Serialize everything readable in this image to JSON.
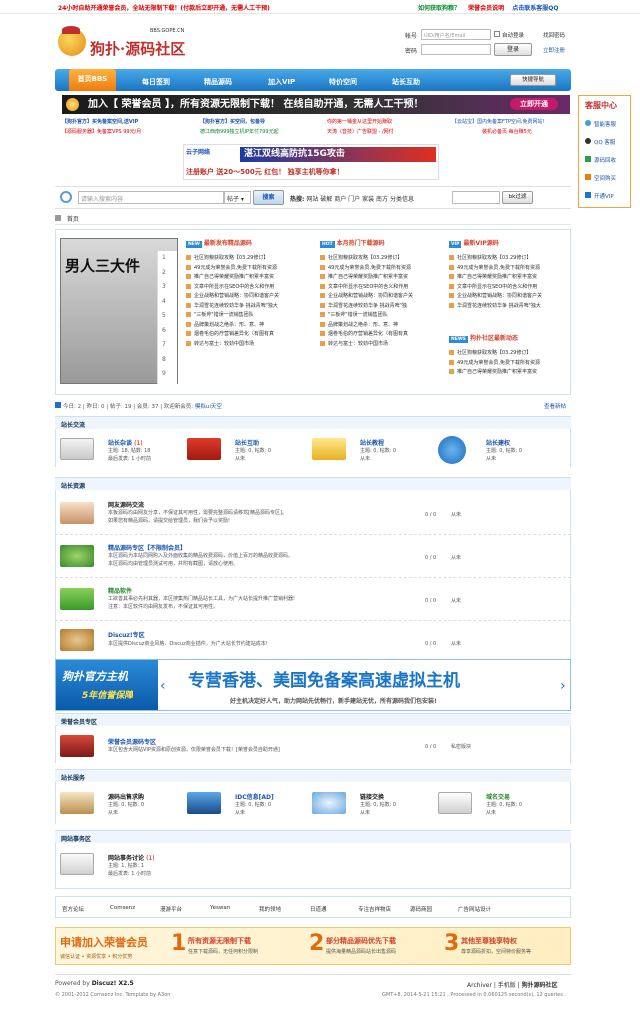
{
  "topbar": {
    "promo": "24小时自助开通荣誉会员，全站无限制下载！(付款后立即开通，无需人工干预)",
    "links": [
      "如何获取狗粮？",
      "荣誉会员说明",
      "点击联系客服QQ"
    ]
  },
  "logo": {
    "name": "狗扑·源码社区",
    "url": "BBS.GOPE.CN"
  },
  "login": {
    "account_label": "帐号",
    "account_placeholder": "UID/用户名/Email",
    "auto_login": "自动登录",
    "forgot": "找回密码",
    "password_label": "密码",
    "login_btn": "登录",
    "register": "立即注册"
  },
  "nav": {
    "items": [
      "首页BBS",
      "每日签到",
      "精品源码",
      "加入VIP",
      "特价空间",
      "站长互助"
    ],
    "quick": "快捷导航"
  },
  "banner": {
    "text": "加入【 荣誉会员 】，所有资源无限制下载！  在线自助开通，无需人工干预！",
    "button": "立即开通"
  },
  "ads": {
    "row1": [
      "【狗扑官方】买免备案空间,送VIP",
      "【狗扑官方】买空间，包备导",
      "你的第一桶金从这里开始赚取",
      "【云站宝】国内免备案FTP空间,免费网站!"
    ],
    "row2": [
      "【源码服务器】免备案VPS 99元/月",
      "德江西南999独立机IP年付799元起",
      "天涛（音技）广告联盟 - /网付",
      "装机必备页 每台赚5元"
    ],
    "middle_main": "湛江双线高防抗15G攻击",
    "middle_sub": "注册账户 送20～500元 红包！ 独享主机等你拿！"
  },
  "sidebar": {
    "title": "客服中心",
    "items": [
      "智能客服",
      "QQ 客服",
      "源码回收",
      "空间购买",
      "开通VIP"
    ]
  },
  "search": {
    "placeholder": "请输入搜索内容",
    "scope": "帖子",
    "button": "搜索",
    "hot_label": "热搜:",
    "hot": [
      "网站",
      "破解",
      "商户",
      "门户",
      "家装",
      "南方",
      "分类信息"
    ],
    "btn2": "bk过滤"
  },
  "breadcrumb": "首页",
  "featured": {
    "image_caption": "男人三大件",
    "columns": [
      {
        "title": "最新发布精品源码",
        "items": [
          "社区狗粮获取攻略【03.29修订】",
          "49元成为荣誉会员,免费下载所有资源",
          "推广自己得荣耀奖励推广积累丰富资",
          "文章中所显示在SEO中的含义和作用",
          "企业战略和营销战略：协同和谐客户关",
          "华润雪花连续较劲华争 挑战青啤\"独大",
          "\"三板斧\"错误一流销售团队",
          "品牌策划战之绝杀：形、意、神",
          "烟卷毛伯的疗营销差异化（有图有真",
          "转达与富士：较劲中国市场"
        ]
      },
      {
        "title": "本月热门下载源码",
        "items": [
          "社区狗粮获取攻略【03.29修订】",
          "49元成为荣誉会员,免费下载所有资源",
          "推广自己得荣耀奖励推广积累丰富资",
          "文章中所显示在SEO中的含义和作用",
          "企业战略和营销战略：协同和谐客户关",
          "华润雪花连续较劲华争 挑战青啤\"独",
          "\"三板斧\"错误一流销售团队",
          "品牌策划战之绝杀：形、意、神",
          "烟卷毛伯的疗营销差异化（有图有真",
          "转达与富士：较劲中国市场"
        ]
      },
      {
        "title": "最新VIP源码",
        "items": [
          "社区狗粮获取攻略【03.29修订】",
          "49元成为荣誉会员,免费下载所有资源",
          "推广自己得荣耀奖励推广积累丰富资",
          "文章中所显示在SEO中的含义和作用",
          "企业战略和营销战略：协同和谐客户关",
          "华润雪花连续较劲华争 挑战青啤\"独大"
        ]
      },
      {
        "title": "狗扑社区最新动态",
        "items": [
          "社区狗粮获取攻略【03.29修订】",
          "49元成为荣誉会员,免费下载所有资源",
          "推广自己得荣耀奖励推广积累丰富资"
        ]
      }
    ]
  },
  "stats": {
    "text": "今日: 2 | 昨日: 0 | 帖子: 19 | 会员: 37 | 欢迎新会员: ",
    "newest": "模拟ui天空",
    "link": "查看新帖"
  },
  "sections": {
    "s1": "站长交流",
    "s2": "站长资源",
    "s3": "荣誉会员专区",
    "s4": "站长服务",
    "s5": "网站事务区"
  },
  "forums_grid1": [
    {
      "name": "站长杂谈",
      "count": "(1)",
      "l1": "主题: 18, 帖数: 18",
      "l2": "最后发表: 1 小时前"
    },
    {
      "name": "站长互助",
      "l1": "主题: 0, 帖数: 0",
      "l2": "从未"
    },
    {
      "name": "站长教程",
      "l1": "主题: 0, 帖数: 0",
      "l2": "从未"
    },
    {
      "name": "站长建权",
      "l1": "主题: 0, 帖数: 0",
      "l2": "从未"
    }
  ],
  "forums_list": [
    {
      "name": "网友源码交流",
      "desc1": "本板源码均由网友分享，不保证其可用性，需要完整源码请移驾[精品源码专区]。",
      "desc2": "如果您有精品源码，请提交给管理员，我们会予以奖励!",
      "num": "0 / 0",
      "last": "从未"
    },
    {
      "name": "精品源码专区【不限制会员】",
      "desc1": "本区源码为本站同网购入及外面收集的精品收费源码，价值上百万的精品收费源码。",
      "desc2": "本区源码均由管理员测试可用，并附有截图，请放心使用。",
      "num": "0 / 0",
      "last": "从未"
    },
    {
      "name": "精品软件",
      "desc1": "工欲善其事必先利其器，本区搜集热门精品站长工具，为广大站长提升推广营销利器!",
      "desc2": "注意：本区软件均由网友发布，不保证其可用性。",
      "num": "0 / 0",
      "last": "从未"
    },
    {
      "name": "Discuz!专区",
      "desc1": "本区提供Discuz商业风格、Discuz商业插件，为广大站长节约建站成本!",
      "num": "0 / 0",
      "last": "从未"
    }
  ],
  "adbanner": {
    "left1": "狗扑官方主机",
    "left2": "5年信誉保障",
    "main": "专营香港、美国免备案高速虚拟主机",
    "sub": "好主机决定好人气，助力网站先优畅行，新手建站无忧，所有源码我们包安装!"
  },
  "vip_forum": {
    "name": "荣誉会员源码专区",
    "desc": "本区包含大网站VIP资源和原创资源，仅限荣誉会员下载！[荣誉会员自助开通]",
    "num": "0 / 0",
    "last": "私密版块"
  },
  "forums_grid2": [
    {
      "name": "源码出售求购",
      "l1": "主题: 0, 帖数: 0",
      "l2": "从未"
    },
    {
      "name": "IDC信息[AD]",
      "l1": "主题: 0, 帖数: 0",
      "l2": "从未"
    },
    {
      "name": "链接交换",
      "l1": "主题: 0, 帖数: 0",
      "l2": "从未"
    },
    {
      "name": "域名交易",
      "l1": "主题: 0, 帖数: 0",
      "l2": "从未"
    }
  ],
  "site_forum": {
    "name": "网站事务讨论",
    "count": "(1)",
    "l1": "主题: 1, 帖数: 1",
    "l2": "最后发表: 1 小时前"
  },
  "friendlinks": [
    "官方论坛",
    "Comsenz",
    "漫游平台",
    "Yeswan",
    "我的领地",
    "日道通",
    "专注吉祥物店",
    "源码商园",
    "广告网站设计"
  ],
  "vipbanner": {
    "title": "申请加入荣誉会员",
    "sub": "诚信认证 • 资源优享 • 积分优势",
    "steps": [
      {
        "n": "1",
        "t": "所有资源无限制下载",
        "s": "任意下载源码，无任何积分限制"
      },
      {
        "n": "2",
        "t": "部分精品源码优先下载",
        "s": "提供海量精品源码站长出售源码"
      },
      {
        "n": "3",
        "t": "其他至尊独享特权",
        "s": "尊享源码折扣，空间特价服务等"
      }
    ]
  },
  "footer": {
    "powered": "Powered by ",
    "brand": "Discuz! X2.5",
    "copy": "© 2001-2012 Comsenz Inc.  Template by A3on",
    "links": [
      "Archiver",
      "手机版",
      "狗扑源码社区"
    ],
    "gmt": "GMT+8, 2014-5-21 15:21 , Processed in 0.060125 second(s), 12 queries ."
  },
  "colors": {
    "accent": "#1a75c4",
    "orange": "#f07a10",
    "red": "#d6442b"
  }
}
